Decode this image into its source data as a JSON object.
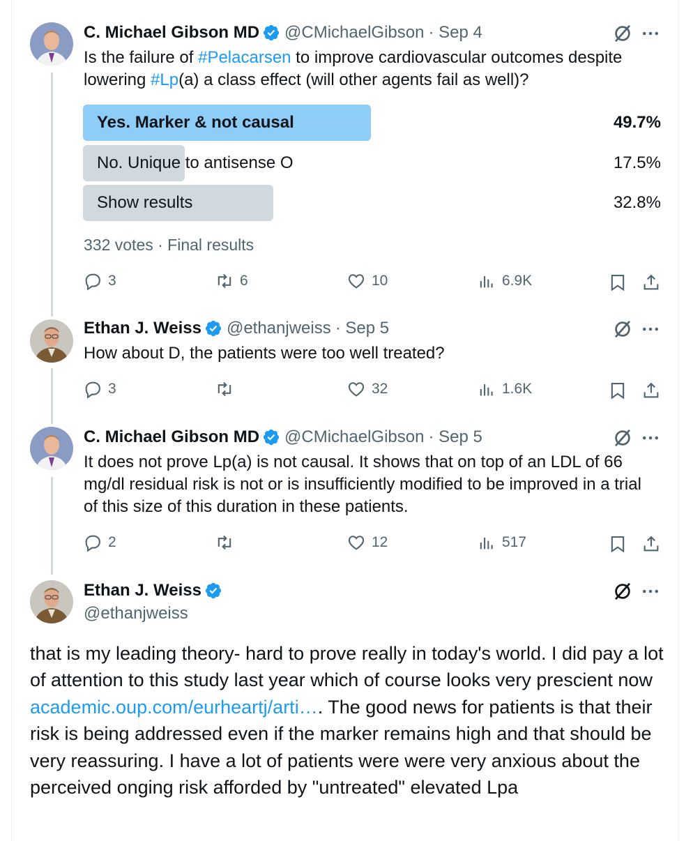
{
  "colors": {
    "link": "#1d9bf0",
    "muted": "#536471",
    "poll_winner": "#8ecdf8",
    "poll_other": "#cfd9de"
  },
  "tweet1": {
    "name": "C. Michael Gibson MD",
    "handle": "@CMichaelGibson",
    "date": "· Sep 4",
    "text_a": "Is the failure of ",
    "hashtag1": "#Pelacarsen",
    "text_b": " to improve cardiovascular outcomes despite lowering ",
    "hashtag2": "#Lp",
    "text_c": "(a) a class effect (will other agents fail as well)?",
    "poll": [
      {
        "label": "Yes. Marker & not causal",
        "percent": "49.7%",
        "value": 49.7
      },
      {
        "label": "No. Unique to antisense O",
        "percent": "17.5%",
        "value": 17.5
      },
      {
        "label": "Show results",
        "percent": "32.8%",
        "value": 32.8
      }
    ],
    "poll_meta": "332 votes · Final results",
    "replies": "3",
    "reposts": "6",
    "likes": "10",
    "views": "6.9K"
  },
  "tweet2": {
    "name": "Ethan J. Weiss",
    "handle": "@ethanjweiss",
    "date": "· Sep 5",
    "text": "How about D, the patients were too well treated?",
    "replies": "3",
    "reposts": "",
    "likes": "32",
    "views": "1.6K"
  },
  "tweet3": {
    "name": "C. Michael Gibson MD",
    "handle": "@CMichaelGibson",
    "date": "· Sep 5",
    "text": "It does not prove Lp(a) is not causal. It shows that on top of an LDL of 66 mg/dl residual risk is not or is insufficiently modified to be improved in a trial of this size of this duration in these patients.",
    "replies": "2",
    "reposts": "",
    "likes": "12",
    "views": "517"
  },
  "tweet4": {
    "name": "Ethan J. Weiss",
    "handle": "@ethanjweiss",
    "text_a": "that is my leading theory- hard to prove really in today's world. I did pay a lot of attention to this study last year which of course looks very prescient now ",
    "link": "academic.oup.com/eurheartj/arti…",
    "text_b": ". The good news for patients is that their risk is being addressed even if the marker remains high and that should be very reassuring. I have a lot of patients were were very anxious about the perceived onging risk afforded by \"untreated\" elevated Lpa"
  },
  "icons": [
    "grok-icon",
    "more-icon",
    "reply-icon",
    "repost-icon",
    "like-icon",
    "views-icon",
    "bookmark-icon",
    "share-icon",
    "verified-badge-icon"
  ]
}
